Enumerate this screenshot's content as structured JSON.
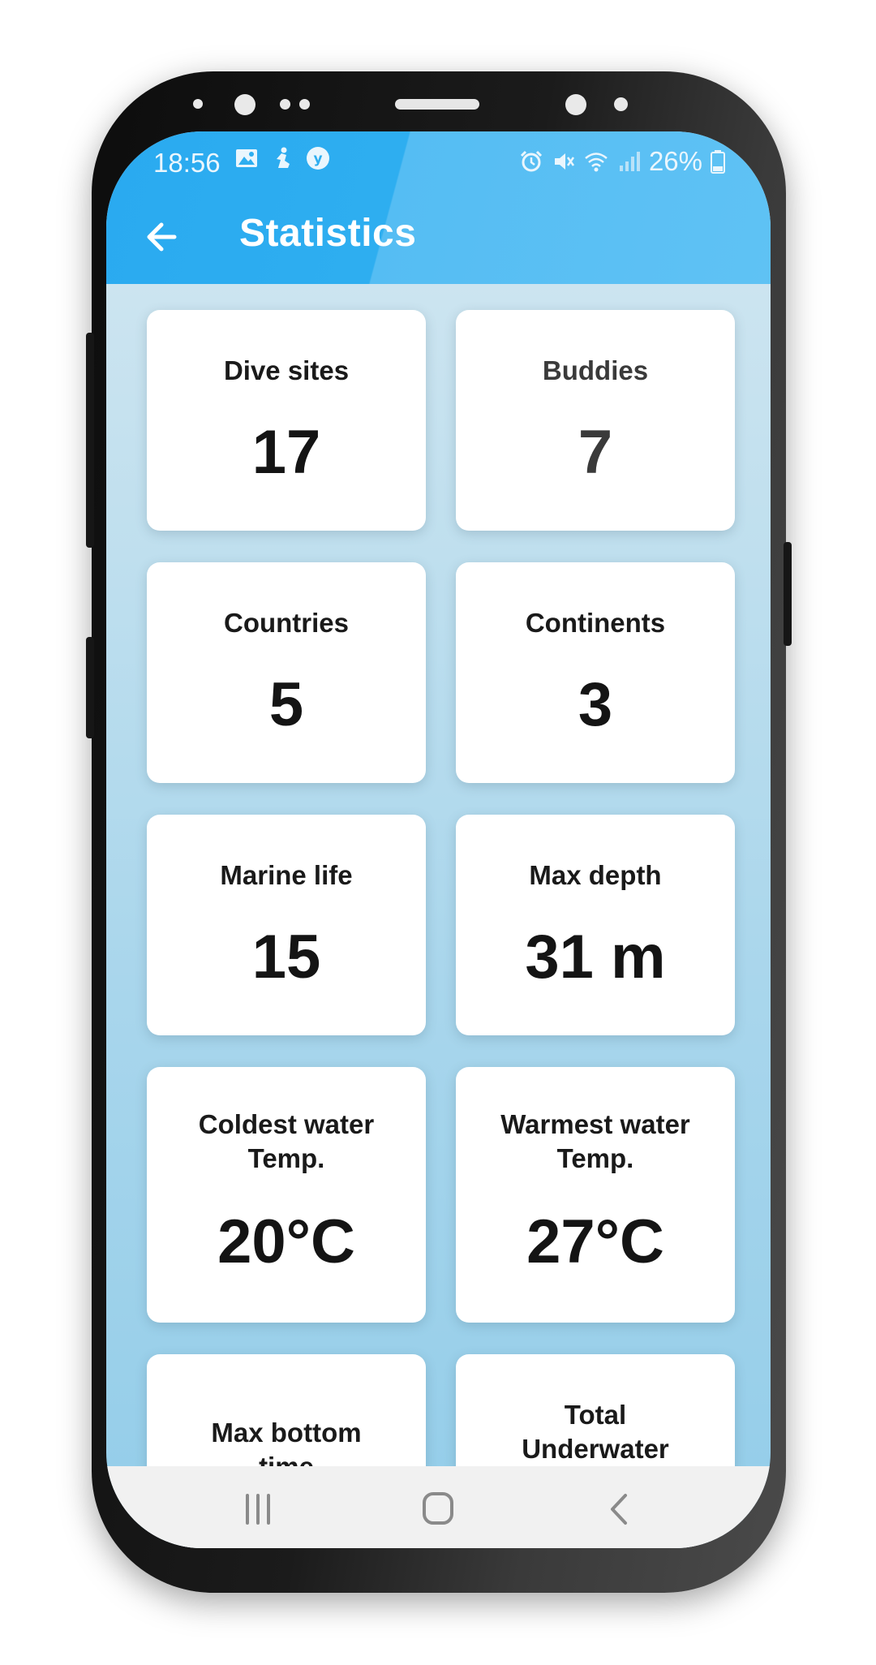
{
  "status_bar": {
    "time": "18:56",
    "battery": "26%"
  },
  "app_bar": {
    "title": "Statistics"
  },
  "stats": [
    {
      "label": "Dive sites",
      "value": "17"
    },
    {
      "label": "Buddies",
      "value": "7"
    },
    {
      "label": "Countries",
      "value": "5"
    },
    {
      "label": "Continents",
      "value": "3"
    },
    {
      "label": "Marine life",
      "value": "15"
    },
    {
      "label": "Max depth",
      "value": "31 m"
    },
    {
      "label": "Coldest water Temp.",
      "value": "20°C"
    },
    {
      "label": "Warmest water Temp.",
      "value": "27°C"
    },
    {
      "label": "Max bottom time",
      "value": ""
    },
    {
      "label": "Total Underwater",
      "value": ""
    }
  ],
  "colors": {
    "app_bar": "#2eaef0",
    "card": "#ffffff",
    "text": "#141414"
  },
  "icons": {
    "back": "arrow-left-icon",
    "nav_recents": "recents-icon",
    "nav_home": "home-icon",
    "nav_back": "chevron-left-icon"
  }
}
